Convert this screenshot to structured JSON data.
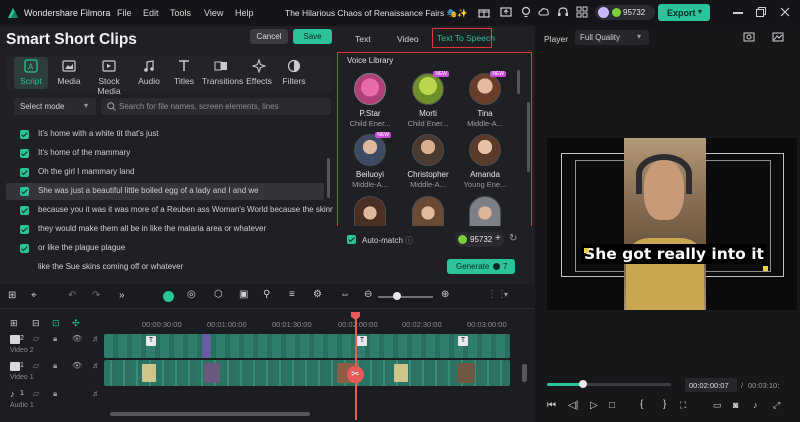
{
  "titlebar": {
    "app_name": "Wondershare Filmora",
    "menu": [
      "File",
      "Edit",
      "Tools",
      "View",
      "Help"
    ],
    "project_title": "The Hilarious Chaos of Renaissance Fairs 🎭✨",
    "credits": "95732",
    "export_label": "Export"
  },
  "panel": {
    "title": "Smart Short Clips",
    "cancel_label": "Cancel",
    "save_label": "Save"
  },
  "tools": [
    {
      "label": "Script",
      "icon": "script-icon"
    },
    {
      "label": "Media",
      "icon": "media-icon"
    },
    {
      "label": "Stock Media",
      "icon": "stock-media-icon"
    },
    {
      "label": "Audio",
      "icon": "audio-icon"
    },
    {
      "label": "Titles",
      "icon": "titles-icon"
    },
    {
      "label": "Transitions",
      "icon": "transitions-icon"
    },
    {
      "label": "Effects",
      "icon": "effects-icon"
    },
    {
      "label": "Filters",
      "icon": "filters-icon"
    }
  ],
  "select_mode": "Select mode",
  "search": {
    "placeholder": "Search for file names, screen elements, lines"
  },
  "script_lines": [
    "It's home with a white tit that's just",
    "It's home of the mammary",
    "Oh the girl I mammary land",
    "She was just a beautiful little boiled egg of a lady and I and we",
    "because you it was it was more of a Reuben ass Woman's World because the skinny girls",
    "they would make them all be in like the malaria area or whatever",
    "or like the plague plague",
    "like the Sue skins coming off or whatever"
  ],
  "mid_tabs": [
    "Text",
    "Video",
    "Text To Speech"
  ],
  "voice_library": {
    "title": "Voice Library",
    "new_badge": "NEW",
    "voices": [
      {
        "name": "P.Star",
        "desc": "Child Ener..."
      },
      {
        "name": "Morti",
        "desc": "Child Ener..."
      },
      {
        "name": "Tina",
        "desc": "Middle-A..."
      },
      {
        "name": "Beiluoyi",
        "desc": "Middle-A..."
      },
      {
        "name": "Christopher",
        "desc": "Middle-A..."
      },
      {
        "name": "Amanda",
        "desc": "Young Ene..."
      }
    ],
    "auto_match": "Auto-match",
    "credits": "95732",
    "generate_label": "Generate",
    "generate_cost": "7"
  },
  "player": {
    "label": "Player",
    "quality": "Full Quality",
    "caption": "She got really into it",
    "current_time": "00:02:00:07",
    "total_time": "00:03:10:",
    "progress": 0.29
  },
  "timeline": {
    "ticks": [
      "00:00:30:00",
      "00:01:00:00",
      "00:01:30:00",
      "00:02:00:00",
      "00:02:30:00",
      "00:03:00:00"
    ],
    "tracks": [
      "Video 2",
      "Video 1",
      "Audio 1"
    ],
    "track_numbers": [
      "2",
      "1",
      "1"
    ]
  },
  "colors": {
    "accent": "#2ac39a",
    "highlight_border": "#e0353b",
    "playhead": "#e85a5a"
  }
}
